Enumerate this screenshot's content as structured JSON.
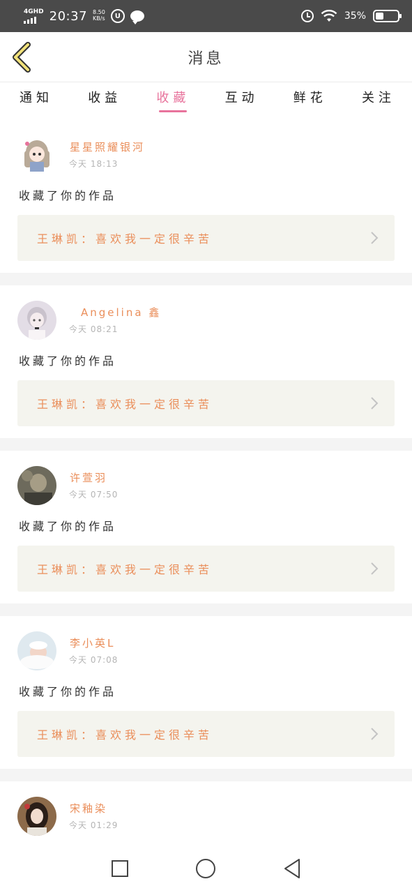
{
  "status_bar": {
    "network": "4GHD",
    "time": "20:37",
    "speed_value": "8.50",
    "speed_unit": "KB/s",
    "battery_percent": "35%",
    "battery_level": 0.35
  },
  "header": {
    "title": "消息"
  },
  "tabs": [
    {
      "label": "通知",
      "active": false
    },
    {
      "label": "收益",
      "active": false
    },
    {
      "label": "收藏",
      "active": true
    },
    {
      "label": "互动",
      "active": false
    },
    {
      "label": "鲜花",
      "active": false
    },
    {
      "label": "关注",
      "active": false
    }
  ],
  "feed": [
    {
      "name": "星星照耀银河",
      "time": "今天 18:13",
      "action": "收藏了你的作品",
      "work": "王琳凯：喜欢我一定很辛苦",
      "avatar": "avatar-anime-girl"
    },
    {
      "name": "Angelina 鑫",
      "time": "今天 08:21",
      "action": "收藏了你的作品",
      "work": "王琳凯：喜欢我一定很辛苦",
      "avatar": "avatar-anime-boy"
    },
    {
      "name": "许萱羽",
      "time": "今天 07:50",
      "action": "收藏了你的作品",
      "work": "王琳凯：喜欢我一定很辛苦",
      "avatar": "avatar-photo-person"
    },
    {
      "name": "李小英L",
      "time": "今天 07:08",
      "action": "收藏了你的作品",
      "work": "王琳凯：喜欢我一定很辛苦",
      "avatar": "avatar-baby"
    },
    {
      "name": "宋釉染",
      "time": "今天 01:29",
      "action": "",
      "work": "",
      "avatar": "avatar-girl-photo"
    }
  ],
  "colors": {
    "accent": "#e8739c",
    "name": "#ea8e5a",
    "work_bg": "#f4f4ee",
    "status_bar": "#4a4a4a"
  },
  "icons": {
    "back": "chevron-left-icon",
    "nav_recent": "square-icon",
    "nav_home": "circle-icon",
    "nav_back": "triangle-back-icon"
  }
}
